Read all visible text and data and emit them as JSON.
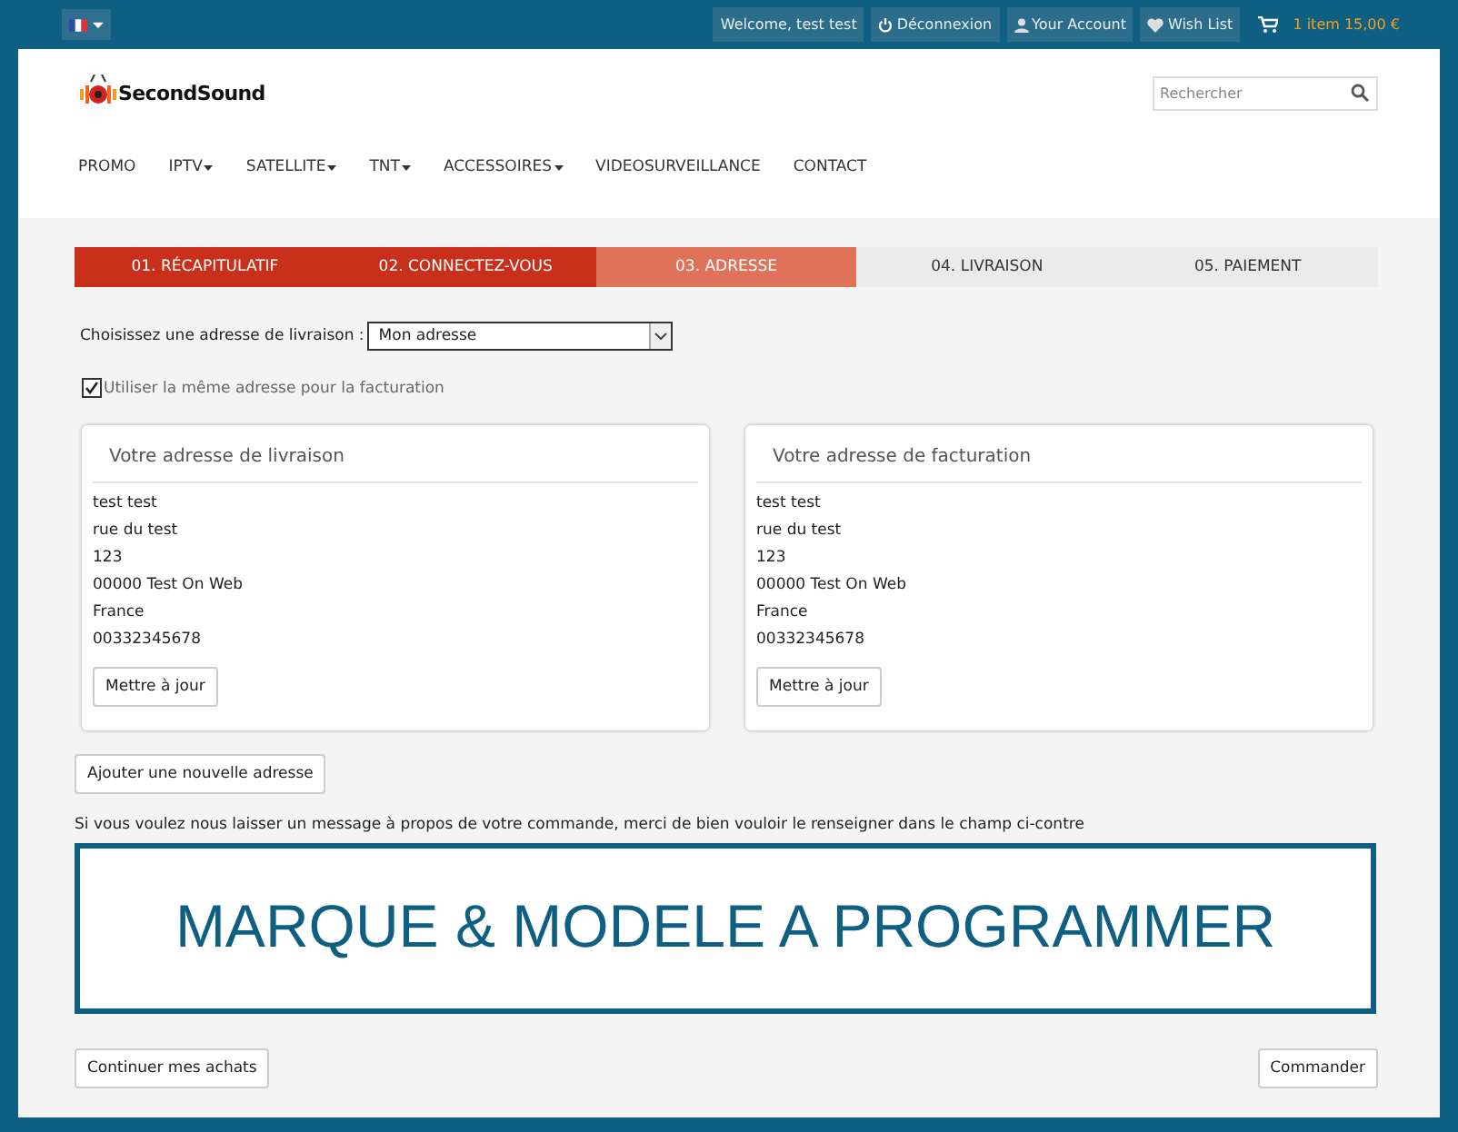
{
  "top_bar": {
    "links": [
      {
        "kind": "text",
        "label": "Welcome, test test"
      },
      {
        "kind": "power",
        "label": "Déconnexion"
      },
      {
        "kind": "user",
        "label": "Your Account"
      },
      {
        "kind": "heart",
        "label": "Wish List"
      }
    ],
    "cart": "1 item 15,00 €"
  },
  "logo": "SecondSound",
  "search": {
    "placeholder": "Rechercher"
  },
  "nav": [
    {
      "label": "PROMO",
      "dropdown": false
    },
    {
      "label": "IPTV",
      "dropdown": true
    },
    {
      "label": "SATELLITE",
      "dropdown": true
    },
    {
      "label": "TNT",
      "dropdown": true
    },
    {
      "label": "ACCESSOIRES",
      "dropdown": true
    },
    {
      "label": "VIDEOSURVEILLANCE",
      "dropdown": false
    },
    {
      "label": "CONTACT",
      "dropdown": false
    }
  ],
  "steps": [
    {
      "label": "01. RÉCAPITULATIF",
      "completed": true,
      "selected": false
    },
    {
      "label": "02. CONNECTEZ-VOUS",
      "completed": true,
      "selected": false
    },
    {
      "label": "03. ADRESSE",
      "completed": false,
      "selected": true
    },
    {
      "label": "04. LIVRAISON",
      "completed": false,
      "selected": false
    },
    {
      "label": "05. PAIEMENT",
      "completed": false,
      "selected": false
    }
  ],
  "address_select": {
    "label": "Choisissez une adresse de livraison :",
    "value": "Mon adresse"
  },
  "same_billing": {
    "label": "Utiliser la même adresse pour la facturation",
    "checked": true
  },
  "addresses": [
    {
      "title": "Votre adresse de livraison",
      "lines": [
        "test test",
        "rue du test",
        "123",
        "00000 Test On Web",
        "France",
        "00332345678"
      ],
      "button": "Mettre à jour"
    },
    {
      "title": "Votre adresse de facturation",
      "lines": [
        "test test",
        "rue du test",
        "123",
        "00000 Test On Web",
        "France",
        "00332345678"
      ],
      "button": "Mettre à jour"
    }
  ],
  "add_address_button": "Ajouter une nouvelle adresse",
  "message": {
    "label": "Si vous voulez nous laisser un message à propos de votre commande, merci de bien vouloir le renseigner dans le champ ci-contre",
    "value": "MARQUE & MODELE A PROGRAMMER"
  },
  "buttons": [
    "Continuer mes achats",
    "Commander"
  ]
}
